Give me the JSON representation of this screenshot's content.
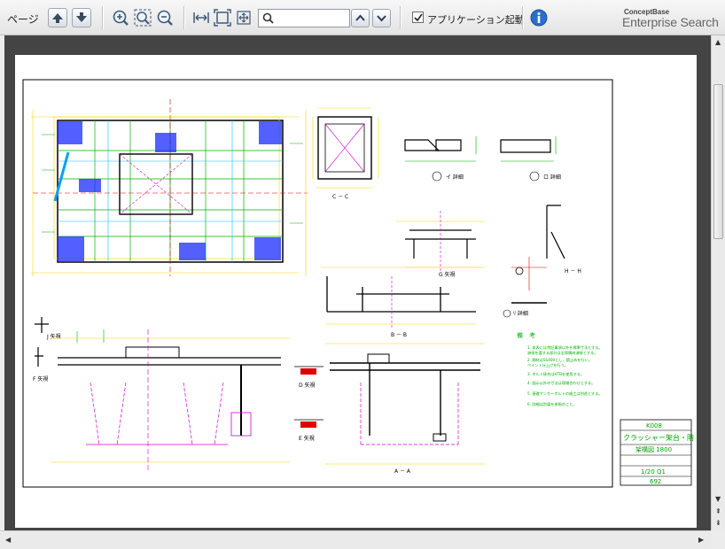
{
  "toolbar": {
    "page_label": "ページ",
    "search_placeholder": "",
    "search_value": "",
    "app_launch_label": "アプリケーション起動",
    "app_launch_checked": true,
    "brand_small": "ConceptBase",
    "brand_large": "Enterprise Search"
  },
  "drawing": {
    "views": {
      "cc": "C － C",
      "a_arrow": "A － A",
      "bb": "B － B",
      "g": "G 矢視",
      "hh": "H － H",
      "j_arrow": "J 矢視",
      "f_arrow": "F 矢視",
      "d_arrow": "D 矢視",
      "e_arrow": "E 矢視",
      "i_detail": "イ 詳細",
      "ro_detail": "ロ 詳細",
      "j_detail": "ﾘ 詳細"
    },
    "notes": {
      "title": "備　考",
      "lines": [
        "1. 本表には特記事項以外を標準寸法とする。",
        "   溶接を要する部分は全周隅肉溶接とする。",
        "2. 鋼材はSS400とし，錆止めを行い，",
        "   ペイント仕上げを行う。",
        "3. ボルト接合はHTBを使用する。",
        "4. 図示以外の寸法は現場合わせとする。",
        "5. 基礎アンカーボルトの施工は別途とする。",
        "6. 詳細は別図を参照のこと。"
      ]
    },
    "title_block": {
      "number": "K008",
      "name": "クラッシャー架台・階",
      "sub": "架構図 1800",
      "scale": "1/20 Q1",
      "sheet": "692"
    }
  }
}
